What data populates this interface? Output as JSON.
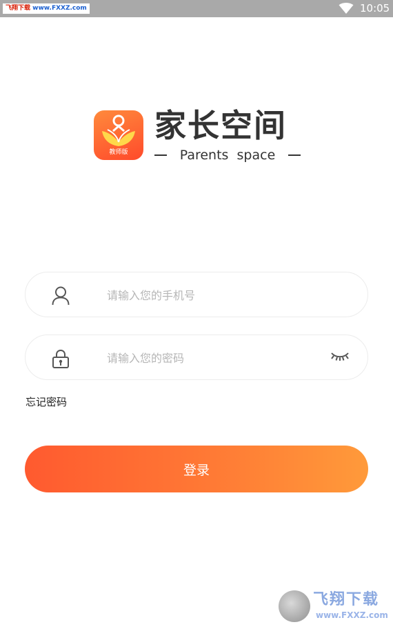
{
  "status_bar": {
    "watermark_site": "飞翔下载",
    "watermark_url": "www.FXXZ.com",
    "time": "10:05"
  },
  "logo": {
    "badge": "教师版",
    "title": "家长空间",
    "subtitle": "Parents  space"
  },
  "login": {
    "phone_placeholder": "请输入您的手机号",
    "password_placeholder": "请输入您的密码",
    "forgot_label": "忘记密码",
    "submit_label": "登录"
  },
  "watermark": {
    "name": "飞翔下载",
    "url": "www.FXXZ.com"
  },
  "colors": {
    "accent_start": "#ff5a2f",
    "accent_end": "#ff9a3a",
    "status_bar": "#a9a9a9",
    "placeholder": "#b6b6b6"
  }
}
